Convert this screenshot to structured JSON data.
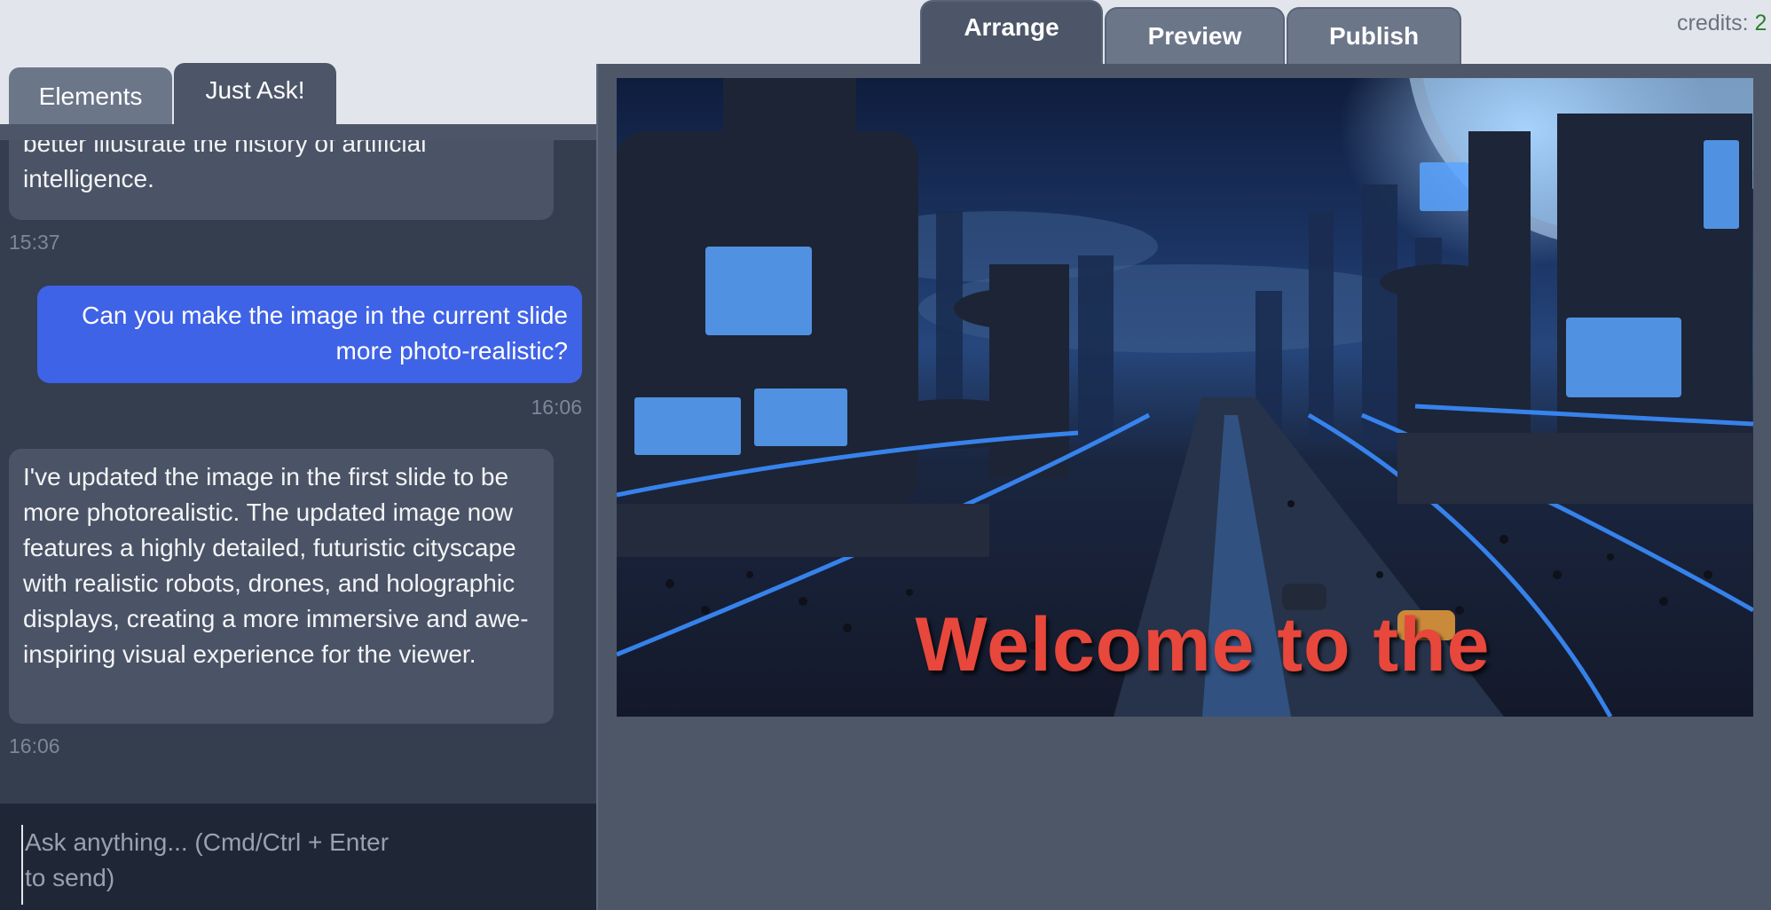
{
  "top_tabs": [
    {
      "label": "Arrange",
      "active": true
    },
    {
      "label": "Preview",
      "active": false
    },
    {
      "label": "Publish",
      "active": false
    }
  ],
  "credits": {
    "label": "credits:",
    "value": "2"
  },
  "left_tabs": [
    {
      "label": "Elements",
      "active": false
    },
    {
      "label": "Just Ask!",
      "active": true
    }
  ],
  "chat": {
    "messages": [
      {
        "role": "assistant",
        "text": "better illustrate the history of artificial intelligence.",
        "time": "15:37"
      },
      {
        "role": "user",
        "text": "Can you make the image in the current slide more photo-realistic?",
        "time": "16:06"
      },
      {
        "role": "assistant",
        "text": "I've updated the image in the first slide to be more photorealistic. The updated image now features a highly detailed, futuristic cityscape with realistic robots, drones, and holographic displays, creating a more immersive and awe-inspiring visual experience for the viewer.",
        "time": "16:06"
      }
    ],
    "input_placeholder": "Ask anything... (Cmd/Ctrl + Enter to send)"
  },
  "slide": {
    "title_text": "Welcome to the",
    "title_color": "#e8473c"
  },
  "colors": {
    "accent_user_bubble": "#3f63e6",
    "panel_dark": "#343e4f",
    "editor_bg": "#4e5768"
  }
}
